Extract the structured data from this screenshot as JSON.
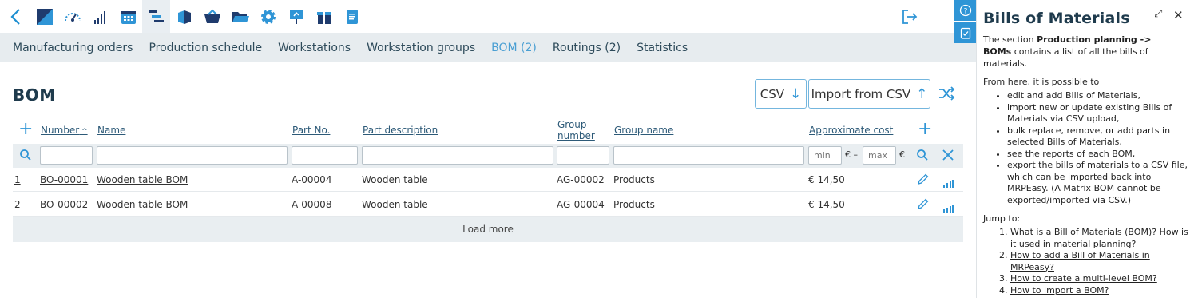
{
  "toolbar": {
    "icons": [
      "back-arrow-icon",
      "app-logo-icon",
      "dashboard-gauge-icon",
      "bar-chart-icon",
      "calendar-icon",
      "production-planning-icon",
      "cube-icon",
      "basket-icon",
      "folder-icon",
      "gear-icon",
      "presentation-icon",
      "gift-icon",
      "document-icon"
    ]
  },
  "subnav": {
    "items": [
      "Manufacturing orders",
      "Production schedule",
      "Workstations",
      "Workstation groups",
      "BOM (2)",
      "Routings (2)",
      "Statistics"
    ]
  },
  "page": {
    "title": "BOM",
    "csv_label": "CSV",
    "import_label": "Import from CSV"
  },
  "table": {
    "headers": {
      "number": "Number",
      "name": "Name",
      "part_no": "Part No.",
      "part_desc": "Part description",
      "group_number_1": "Group",
      "group_number_2": "number",
      "group_name": "Group name",
      "approx_cost": "Approximate cost"
    },
    "filters": {
      "min_placeholder": "min",
      "max_placeholder": "max",
      "euro_dash": "€ –",
      "euro": "€"
    },
    "rows": [
      {
        "idx": "1",
        "number": "BO-00001",
        "name": "Wooden table BOM",
        "part_no": "A-00004",
        "part_desc": "Wooden table",
        "group_number": "AG-00002",
        "group_name": "Products",
        "cost": "€ 14,50"
      },
      {
        "idx": "2",
        "number": "BO-00002",
        "name": "Wooden table BOM",
        "part_no": "A-00008",
        "part_desc": "Wooden table",
        "group_number": "AG-00004",
        "group_name": "Products",
        "cost": "€ 14,50"
      }
    ],
    "load_more": "Load more"
  },
  "help": {
    "title": "Bills of Materials",
    "intro_pre": "The section ",
    "intro_bold1": "Production planning ->",
    "intro_bold2": "BOMs",
    "intro_post": " contains a list of all the bills of materials.",
    "from_here": "From here, it is possible to",
    "bullets": [
      "edit and add Bills of Materials,",
      "import new or update existing Bills of Materials via CSV upload,",
      "bulk replace, remove, or add parts in selected Bills of Materials,",
      "see the reports of each BOM,",
      "export the bills of materials to a CSV file, which can be imported back into MRPEasy. (A Matrix BOM cannot be exported/imported via CSV.)"
    ],
    "jump_to": "Jump to:",
    "links": [
      "What is a Bill of Materials (BOM)? How is it used in material planning?",
      "How to add a Bill of Materials in MRPeasy?",
      "How to create a multi-level BOM?",
      "How to import a BOM?"
    ]
  },
  "colors": {
    "accent": "#2f95d6",
    "subnav_bg": "#e7ecef",
    "title": "#1f3b4d"
  }
}
